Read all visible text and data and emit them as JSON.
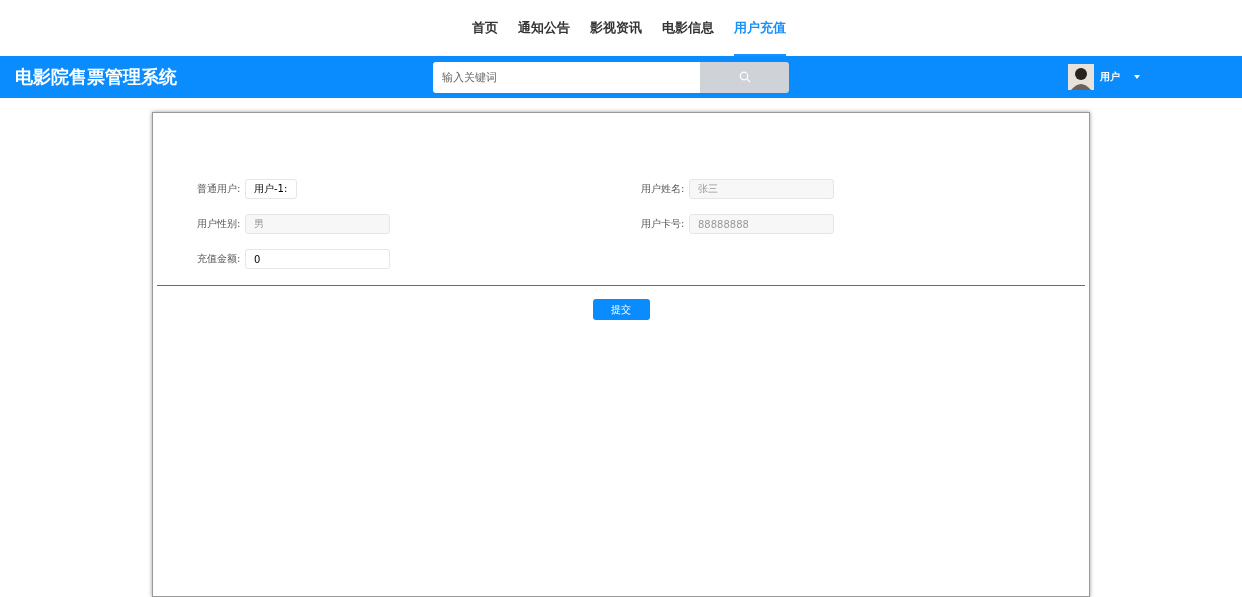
{
  "nav": [
    {
      "label": "首页",
      "selected": false
    },
    {
      "label": "通知公告",
      "selected": false
    },
    {
      "label": "影视资讯",
      "selected": false
    },
    {
      "label": "电影信息",
      "selected": false
    },
    {
      "label": "用户充值",
      "selected": true
    }
  ],
  "header": {
    "title": "电影院售票管理系统",
    "search": {
      "placeholder": "输入关键词"
    },
    "user": {
      "name": "用户"
    }
  },
  "form": {
    "rows": [
      {
        "left": {
          "label": "普通用户:",
          "value": "用户-1:",
          "kind": "short",
          "disabled": false
        },
        "right": {
          "label": "用户姓名:",
          "value": "张三",
          "kind": "wide",
          "disabled": true
        }
      },
      {
        "left": {
          "label": "用户性别:",
          "value": "男",
          "kind": "wide",
          "disabled": true
        },
        "right": {
          "label": "用户卡号:",
          "value": "88888888",
          "kind": "wide",
          "disabled": true
        }
      },
      {
        "left": {
          "label": "充值金额:",
          "value": "0",
          "kind": "wide",
          "disabled": false
        }
      }
    ],
    "submit": "提交"
  }
}
